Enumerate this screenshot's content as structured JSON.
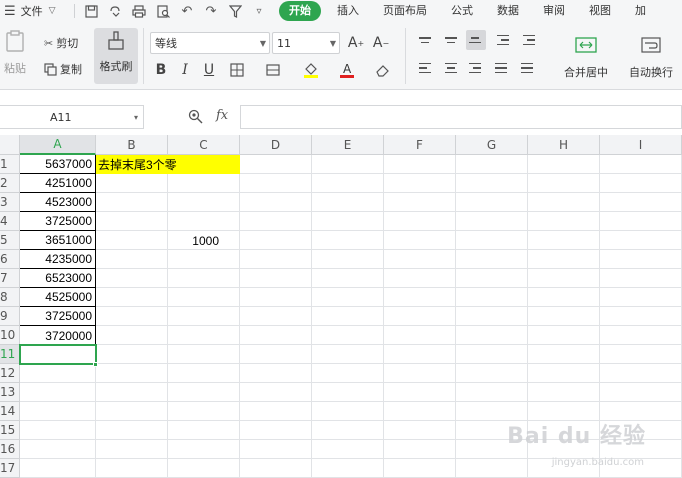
{
  "menubar": {
    "file_label": "文件",
    "tabs": [
      {
        "label": "开始",
        "active": true
      },
      {
        "label": "插入"
      },
      {
        "label": "页面布局"
      },
      {
        "label": "公式"
      },
      {
        "label": "数据"
      },
      {
        "label": "审阅"
      },
      {
        "label": "视图"
      },
      {
        "label": "加"
      }
    ]
  },
  "ribbon": {
    "paste": "粘贴",
    "cut": "剪切",
    "copy": "复制",
    "format_painter": "格式刷",
    "font_name": "等线",
    "font_size": "11",
    "merge_center": "合并居中",
    "wrap_text": "自动换行"
  },
  "formula_bar": {
    "name_box": "A11",
    "fx": "fx",
    "formula": ""
  },
  "columns": [
    "A",
    "B",
    "C",
    "D",
    "E",
    "F",
    "G",
    "H",
    "I"
  ],
  "rows": [
    "1",
    "2",
    "3",
    "4",
    "5",
    "6",
    "7",
    "8",
    "9",
    "10",
    "11",
    "12",
    "13",
    "14",
    "15",
    "16",
    "17"
  ],
  "cells": {
    "A": [
      "5637000",
      "4251000",
      "4523000",
      "3725000",
      "3651000",
      "4235000",
      "6523000",
      "4525000",
      "3725000",
      "3720000"
    ],
    "B1": "去掉末尾3个零",
    "C5": "1000"
  },
  "selected_cell": "A11",
  "colors": {
    "accent": "#2ea54f",
    "highlight": "#ffff00"
  },
  "watermark": {
    "main": "Bai du 经验",
    "sub": "jingyan.baidu.com"
  }
}
